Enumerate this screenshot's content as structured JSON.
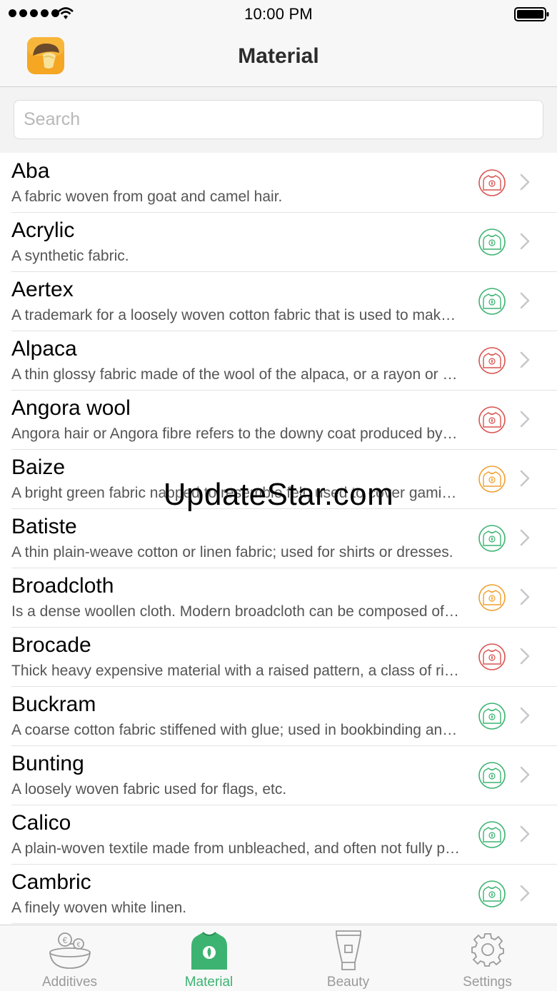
{
  "status_bar": {
    "time": "10:00 PM"
  },
  "nav": {
    "title": "Material",
    "app_icon": "mushroom-app-icon"
  },
  "search": {
    "placeholder": "Search",
    "value": ""
  },
  "colors": {
    "red": "#d9534f",
    "green": "#3cb371",
    "orange": "#f0a030",
    "accent": "#3cb371"
  },
  "items": [
    {
      "title": "Aba",
      "subtitle": "A fabric woven from goat and camel hair.",
      "status": "red"
    },
    {
      "title": "Acrylic",
      "subtitle": "A synthetic fabric.",
      "status": "green"
    },
    {
      "title": "Aertex",
      "subtitle": "A trademark for a loosely woven cotton fabric that is used to make shirts and underwear.",
      "status": "green"
    },
    {
      "title": "Alpaca",
      "subtitle": "A thin glossy fabric made of the wool of the alpaca, or a rayon or cotton imitation.",
      "status": "red"
    },
    {
      "title": "Angora wool",
      "subtitle": "Angora hair or Angora fibre refers to the downy coat produced by the Angora rabbit.",
      "status": "red"
    },
    {
      "title": "Baize",
      "subtitle": "A bright green fabric napped to resemble felt; used to cover gaming tables.",
      "status": "orange"
    },
    {
      "title": "Batiste",
      "subtitle": "A thin plain-weave cotton or linen fabric; used for shirts or dresses.",
      "status": "green"
    },
    {
      "title": "Broadcloth",
      "subtitle": "Is a dense woollen cloth. Modern broadcloth can be composed of cotton or silk.",
      "status": "orange"
    },
    {
      "title": "Brocade",
      "subtitle": "Thick heavy expensive material with a raised pattern, a class of richly decorative fabrics.",
      "status": "red"
    },
    {
      "title": "Buckram",
      "subtitle": "A coarse cotton fabric stiffened with glue; used in bookbinding and to stiffen clothing.",
      "status": "green"
    },
    {
      "title": "Bunting",
      "subtitle": "A loosely woven fabric used for flags, etc.",
      "status": "green"
    },
    {
      "title": "Calico",
      "subtitle": "A plain-woven textile made from unbleached, and often not fully processed, cotton.",
      "status": "green"
    },
    {
      "title": "Cambric",
      "subtitle": "A finely woven white linen.",
      "status": "green"
    }
  ],
  "watermark": "UpdateStar.com",
  "tabs": [
    {
      "label": "Additives",
      "icon": "bowl-icon",
      "active": false
    },
    {
      "label": "Material",
      "icon": "sweater-icon",
      "active": true
    },
    {
      "label": "Beauty",
      "icon": "tube-icon",
      "active": false
    },
    {
      "label": "Settings",
      "icon": "gear-icon",
      "active": false
    }
  ]
}
